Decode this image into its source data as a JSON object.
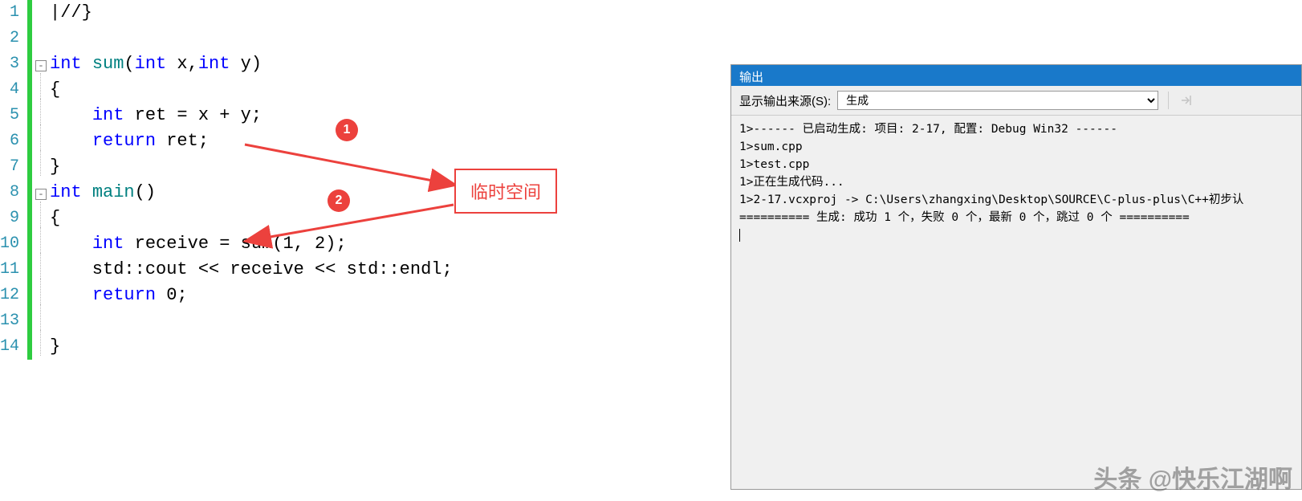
{
  "editor": {
    "lines": [
      {
        "num": "1",
        "fold": "",
        "html": "<span class='op'>|//}</span>"
      },
      {
        "num": "2",
        "fold": "",
        "html": ""
      },
      {
        "num": "3",
        "fold": "-",
        "html": "<span class='kw'>int</span> <span class='ident'>sum</span>(<span class='kw'>int</span> x,<span class='kw'>int</span> y)"
      },
      {
        "num": "4",
        "fold": "|",
        "html": "{"
      },
      {
        "num": "5",
        "fold": "|",
        "html": "    <span class='kw'>int</span> ret = x + y;"
      },
      {
        "num": "6",
        "fold": "|",
        "html": "    <span class='kw'>return</span> ret;"
      },
      {
        "num": "7",
        "fold": "|",
        "html": "}"
      },
      {
        "num": "8",
        "fold": "-",
        "html": "<span class='kw'>int</span> <span class='ident'>main</span>()"
      },
      {
        "num": "9",
        "fold": "|",
        "html": "{"
      },
      {
        "num": "10",
        "fold": "|",
        "html": "    <span class='kw'>int</span> receive = sum(1, 2);"
      },
      {
        "num": "11",
        "fold": "|",
        "html": "    std::cout &lt;&lt; receive &lt;&lt; std::endl;"
      },
      {
        "num": "12",
        "fold": "|",
        "html": "    <span class='kw'>return</span> 0;"
      },
      {
        "num": "13",
        "fold": "|",
        "html": ""
      },
      {
        "num": "14",
        "fold": "|",
        "html": "}"
      }
    ]
  },
  "annotations": {
    "badge1": "1",
    "badge2": "2",
    "label": "临时空间"
  },
  "output": {
    "title": "输出",
    "source_label": "显示输出来源(S):",
    "source_value": "生成",
    "log_lines": [
      "1>------ 已启动生成: 项目: 2-17, 配置: Debug Win32 ------",
      "1>sum.cpp",
      "1>test.cpp",
      "1>正在生成代码...",
      "1>2-17.vcxproj -> C:\\Users\\zhangxing\\Desktop\\SOURCE\\C-plus-plus\\C++初步认",
      "========== 生成: 成功 1 个，失败 0 个，最新 0 个，跳过 0 个 =========="
    ]
  },
  "watermark": "头条 @快乐江湖啊"
}
